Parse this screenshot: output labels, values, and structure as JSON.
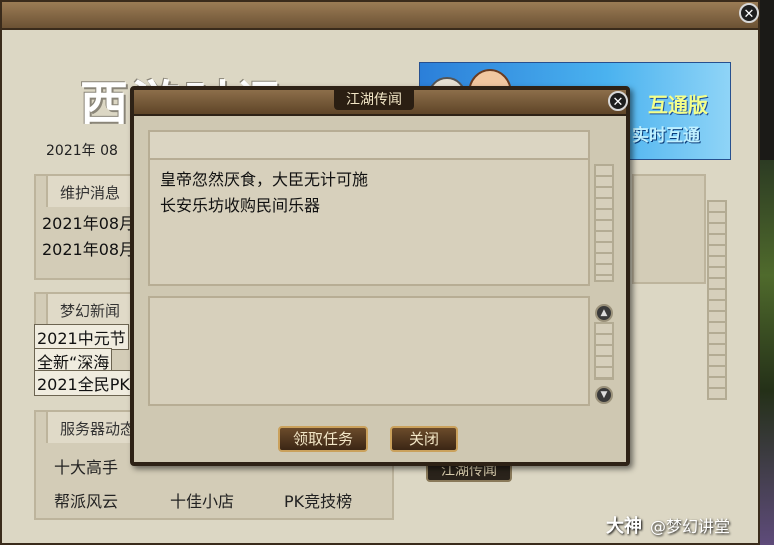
{
  "background": {
    "big_title": "西游时讯",
    "date_text": "2021年  08",
    "banner": {
      "text1": "互通版",
      "text2": "实时互通"
    },
    "maintenance": {
      "heading": "维护消息",
      "lines": [
        "2021年08月",
        "2021年08月"
      ]
    },
    "news": {
      "heading": "梦幻新闻",
      "lines": [
        "2021中元节",
        "全新“深海",
        "2021全民PK"
      ]
    },
    "server": {
      "heading": "服务器动态",
      "items_row1": [
        "十大高手",
        "",
        ""
      ],
      "items_row2": [
        "帮派风云",
        "十佳小店",
        "PK竞技榜"
      ]
    },
    "jianghu_button": "江湖传闻"
  },
  "dialog": {
    "title": "江湖传闻",
    "rumors": [
      "皇帝忽然厌食，大臣无计可施",
      "长安乐坊收购民间乐器"
    ],
    "accept_button": "领取任务",
    "close_button": "关闭"
  },
  "icons": {
    "close": "close-icon",
    "scroll_up": "scroll-up-icon",
    "scroll_down": "scroll-down-icon"
  },
  "watermark": {
    "logo": "大神",
    "handle": "@梦幻讲堂"
  }
}
